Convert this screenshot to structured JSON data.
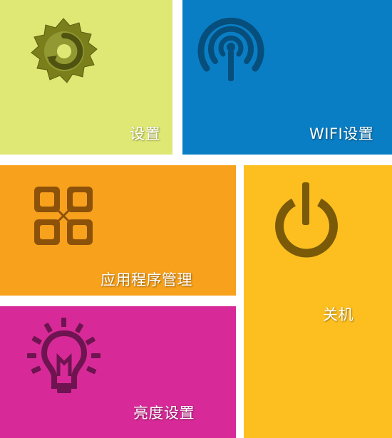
{
  "colors": {
    "settings": "#DFE874",
    "wifi": "#0A7EC4",
    "apps": "#F7A11C",
    "power": "#FDBF1F",
    "brightness": "#D72A98",
    "label": "#FFFFFF"
  },
  "tiles": {
    "settings": {
      "label": "设置",
      "icon": "settings-gear-icon"
    },
    "wifi": {
      "label": "WIFI设置",
      "icon": "wifi-signal-icon"
    },
    "apps": {
      "label": "应用程序管理",
      "icon": "apps-grid-icon"
    },
    "power": {
      "label": "关机",
      "icon": "power-icon"
    },
    "brightness": {
      "label": "亮度设置",
      "icon": "lightbulb-icon"
    }
  }
}
